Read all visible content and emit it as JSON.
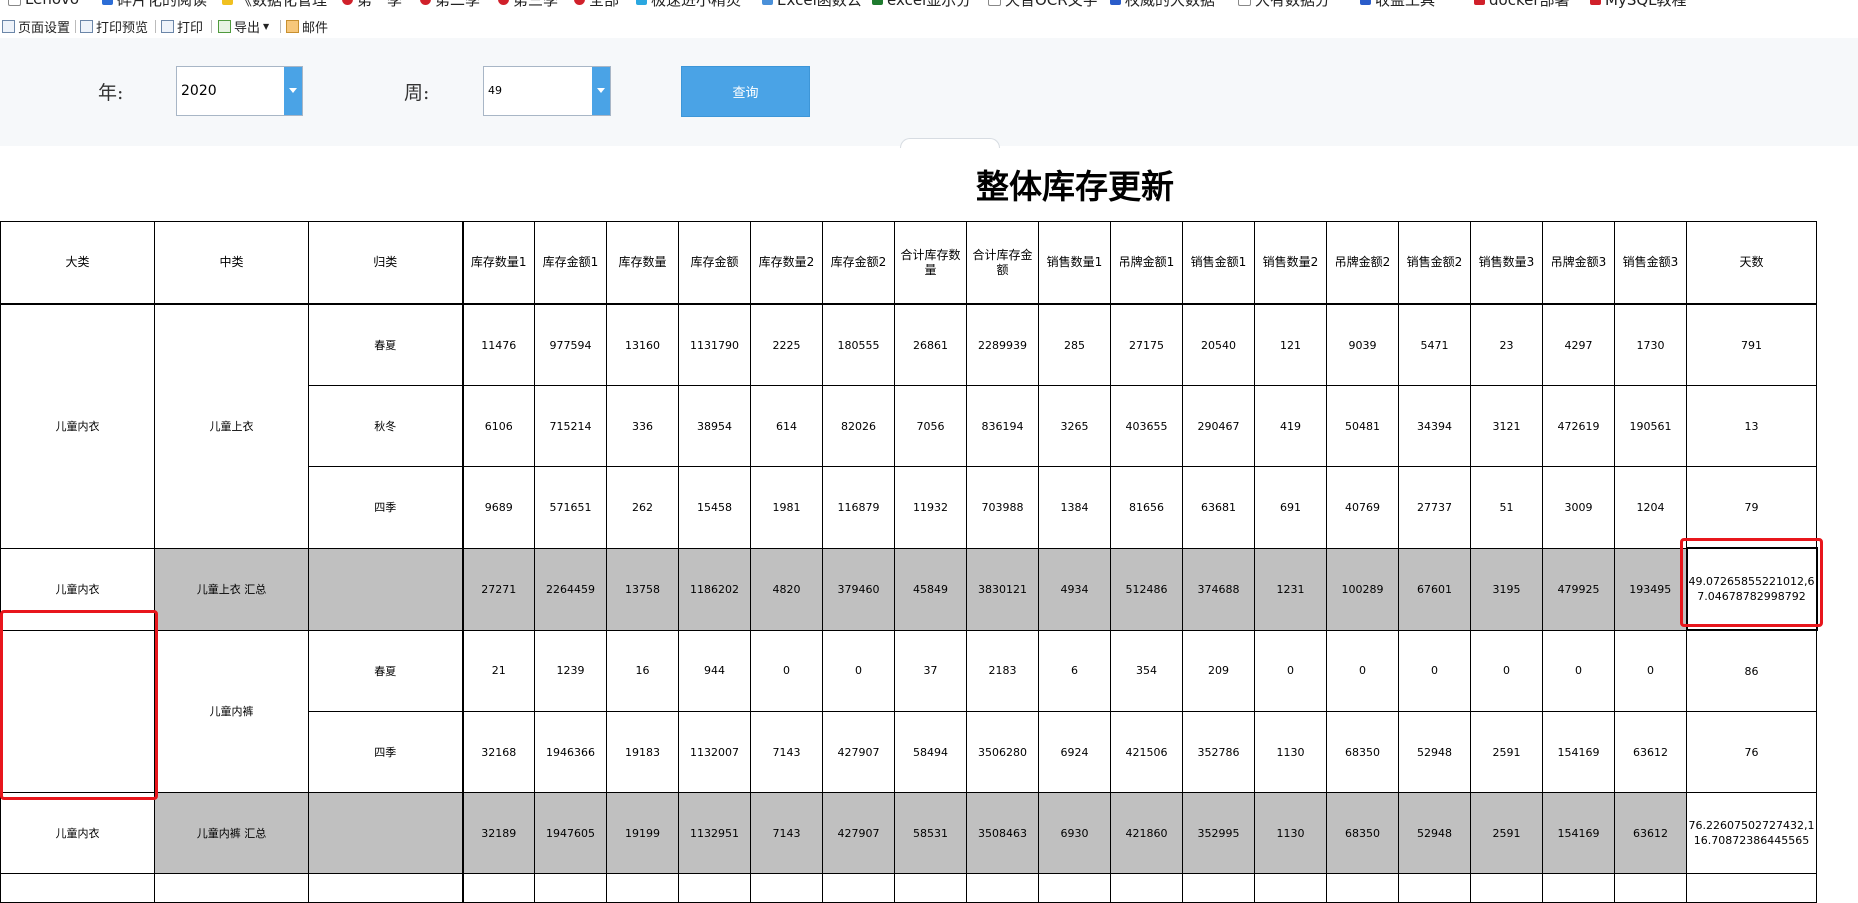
{
  "bookmarks": [
    "Lenovo",
    "碎片化的阅读",
    "《数据化管理",
    "第一季",
    "第二季",
    "第三季",
    "全部",
    "极速进小精灵",
    "Excel函数公",
    "excel显示分",
    "天音OCR文字",
    "权威的大数据",
    "大有数据分",
    "收益工具",
    "docker部署",
    "MySQL教程"
  ],
  "toolbar": {
    "page_setup": "页面设置",
    "print_preview": "打印预览",
    "print": "打印",
    "export": "导出",
    "mail": "邮件"
  },
  "filters": {
    "year_label": "年:",
    "year_value": "2020",
    "week_label": "周:",
    "week_value": "49",
    "query_label": "查询"
  },
  "report_title": "整体库存更新",
  "colors": {
    "accent": "#4aa3e6",
    "subtotal_bg": "#c0c0c0",
    "highlight": "#e8161c"
  },
  "table": {
    "headers": [
      "大类",
      "中类",
      "归类",
      "库存数量1",
      "库存金额1",
      "库存数量",
      "库存金额",
      "库存数量2",
      "库存金额2",
      "合计库存数量",
      "合计库存金额",
      "销售数量1",
      "吊牌金额1",
      "销售金额1",
      "销售数量2",
      "吊牌金额2",
      "销售金额2",
      "销售数量3",
      "吊牌金额3",
      "销售金额3",
      "天数"
    ],
    "rows": [
      {
        "category": "儿童内衣",
        "mid": "儿童上衣",
        "type": "春夏",
        "values": [
          "11476",
          "977594",
          "13160",
          "1131790",
          "2225",
          "180555",
          "26861",
          "2289939",
          "285",
          "27175",
          "20540",
          "121",
          "9039",
          "5471",
          "23",
          "4297",
          "1730"
        ],
        "days": "791"
      },
      {
        "type": "秋冬",
        "values": [
          "6106",
          "715214",
          "336",
          "38954",
          "614",
          "82026",
          "7056",
          "836194",
          "3265",
          "403655",
          "290467",
          "419",
          "50481",
          "34394",
          "3121",
          "472619",
          "190561"
        ],
        "days": "13"
      },
      {
        "type": "四季",
        "values": [
          "9689",
          "571651",
          "262",
          "15458",
          "1981",
          "116879",
          "11932",
          "703988",
          "1384",
          "81656",
          "63681",
          "691",
          "40769",
          "27737",
          "51",
          "3009",
          "1204"
        ],
        "days": "79"
      },
      {
        "category": "儿童内衣",
        "mid": "儿童上衣 汇总",
        "type": "",
        "values": [
          "27271",
          "2264459",
          "13758",
          "1186202",
          "4820",
          "379460",
          "45849",
          "3830121",
          "4934",
          "512486",
          "374688",
          "1231",
          "100289",
          "67601",
          "3195",
          "479925",
          "193495"
        ],
        "days": "49.07265855221012,67.04678782998792"
      },
      {
        "category": "",
        "mid": "儿童内裤",
        "type": "春夏",
        "values": [
          "21",
          "1239",
          "16",
          "944",
          "0",
          "0",
          "37",
          "2183",
          "6",
          "354",
          "209",
          "0",
          "0",
          "0",
          "0",
          "0",
          "0"
        ],
        "days": "86"
      },
      {
        "type": "四季",
        "values": [
          "32168",
          "1946366",
          "19183",
          "1132007",
          "7143",
          "427907",
          "58494",
          "3506280",
          "6924",
          "421506",
          "352786",
          "1130",
          "68350",
          "52948",
          "2591",
          "154169",
          "63612"
        ],
        "days": "76"
      },
      {
        "category": "儿童内衣",
        "mid": "儿童内裤 汇总",
        "type": "",
        "values": [
          "32189",
          "1947605",
          "19199",
          "1132951",
          "7143",
          "427907",
          "58531",
          "3508463",
          "6930",
          "421860",
          "352995",
          "1130",
          "68350",
          "52948",
          "2591",
          "154169",
          "63612"
        ],
        "days": "76.22607502727432,116.70872386445565"
      }
    ]
  }
}
